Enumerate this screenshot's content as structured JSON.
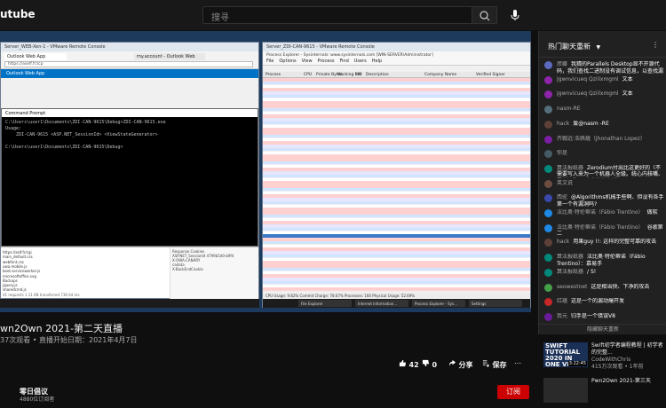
{
  "yt": {
    "logo": "utube",
    "search_placeholder": "搜寻"
  },
  "vm_left": {
    "title": "Server_WEB-Xen-1 - VMware Remote Console",
    "tab1": "Outlook Web App",
    "tab2": "my.account - Outlook Web",
    "url": "https://aself.fr.tcp",
    "owa_label": "Outlook Web App",
    "cmd_title": "Command Prompt",
    "cmd_lines": [
      "C:\\Users\\user1\\Documents\\ZDI-CAN-9615\\Debug>ZDI-CAN-9615.exe",
      "Usage:",
      "    ZDI-CAN-9615 <ASP.NET_SessionId> <ViewStateGenerator>",
      "",
      "C:\\Users\\user1\\Documents\\ZDI-CAN-9615\\Debug>"
    ],
    "devtools_rows": [
      "https://self.fr/cgi",
      "main_default.css",
      "webfont.css",
      "owa.mobile.js",
      "boot.serviceworker.js",
      "microsoftoffice.svg",
      "Backups",
      "jquery.js",
      "sharedcmd.js"
    ],
    "devtools_right": [
      "Response Cookies",
      "ASP.NET_SessionId  4799b5d0-b9f4",
      "X-OWA-CANARY",
      "cadata",
      "X-BackEndCookie"
    ],
    "devtools_footer": "41 requests    1.11 KB transferred    736.64 ms"
  },
  "vm_right": {
    "title": "Server_ZDI-CAN-9615 - VMware Remote Console",
    "pe_title": "Process Explorer - Sysinternals: www.sysinternals.com [WIN-SERVER\\Administrator]",
    "menu": [
      "File",
      "Options",
      "View",
      "Process",
      "Find",
      "Users",
      "Help"
    ],
    "columns": [
      "Process",
      "CPU",
      "Private Bytes",
      "Working Set",
      "PID",
      "Description",
      "Company Name",
      "Verified Signer"
    ],
    "status": "CPU Usage: 9.82%   Commit Charge: 78.67%   Processes: 160   Physical Usage: 52.69%",
    "taskbar": [
      "File Explorer",
      "Internet Information...",
      "Process Explorer - Sys...",
      "Settings"
    ]
  },
  "video": {
    "progress": 0.14,
    "title": "wn2Own 2021-第二天直播",
    "meta": "37次观看 • 直播开始日期：2021年4月7日",
    "likes": "42",
    "dislikes": "0",
    "share": "分享",
    "save": "保存",
    "channel": "零日倡议",
    "subs": "4880位订阅者",
    "subscribe": "订阅"
  },
  "chat": {
    "header": "热门聊天重新",
    "footer": "隐藏聊天重新",
    "messages": [
      {
        "author": "彦藤",
        "text": "我猜的Parallels Desktop显不开源代码，我们查找二进制没有调试信息，以查找漏洞",
        "color": "#5c6bc0"
      },
      {
        "author": "Jgwnvicueq Qziilxmgml",
        "text": "文本",
        "color": "#8e24aa"
      },
      {
        "author": "Jgwnvicueq Qziilxmgml",
        "text": "文本",
        "color": "#8e24aa"
      },
      {
        "author": "nasm-RE",
        "text": "",
        "color": "#546e7a"
      },
      {
        "author": "hack",
        "text": "爱@nasm -RE",
        "color": "#5d4037"
      },
      {
        "author": "齐翰远·浩佩蕴（Jhonathan Lopez）",
        "text": "",
        "color": "#7b1fa2"
      },
      {
        "author": "你是",
        "text": "",
        "color": "#455a64"
      },
      {
        "author": "算法报纸器",
        "text": "Zerodium付出比这更好的（不需要写入来为一个机器人全级。统心内核嘴、零点）和 ：攻击的持久性）。",
        "color": "#00897b"
      },
      {
        "author": "英文说",
        "text": "",
        "color": "#6d4c41"
      },
      {
        "author": "西驼",
        "text": "@Algorithms机械手些啊、但没有各手第一个有漏洞吗?",
        "color": "#3949ab"
      },
      {
        "author": "法比奥·特伦蒂诺（Fábio Trentino）",
        "text": "做软",
        "color": "#1e88e5"
      },
      {
        "author": "法比奥·特伦蒂诺（Fábio Trentino）",
        "text": "谷歌第二",
        "color": "#1e88e5"
      },
      {
        "author": "hack",
        "text": "用果guy !!: 这样的完整可靠的攻击",
        "color": "#5d4037"
      },
      {
        "author": "算法报纸器",
        "text": "法比奥·特伦蒂诺（Fábio Trentino）：慕易手",
        "color": "#00897b"
      },
      {
        "author": "算法报纸器",
        "text": "/ S!",
        "color": "#00897b"
      },
      {
        "author": "seowestnet",
        "text": "这是相当快、下净的攻击",
        "color": "#43a047"
      },
      {
        "author": "红蕴",
        "text": "这是一个的漏动爆开发",
        "color": "#c62828"
      },
      {
        "author": "我元",
        "text": "归手是一个错误V8",
        "color": "#6a1b9a"
      }
    ]
  },
  "recs": [
    {
      "thumb": "SWIFT TUTORIAL 2020 IN ONE VIDEO",
      "duration": "3:22:45",
      "title": "Swift初学者编程教程 | 初学者的完整...",
      "channel": "CodeWithChris",
      "views": "415万次观看 • 1年前"
    },
    {
      "thumb": "",
      "duration": "",
      "title": "Pwn2Own 2021-第三天",
      "channel": "",
      "views": ""
    }
  ]
}
